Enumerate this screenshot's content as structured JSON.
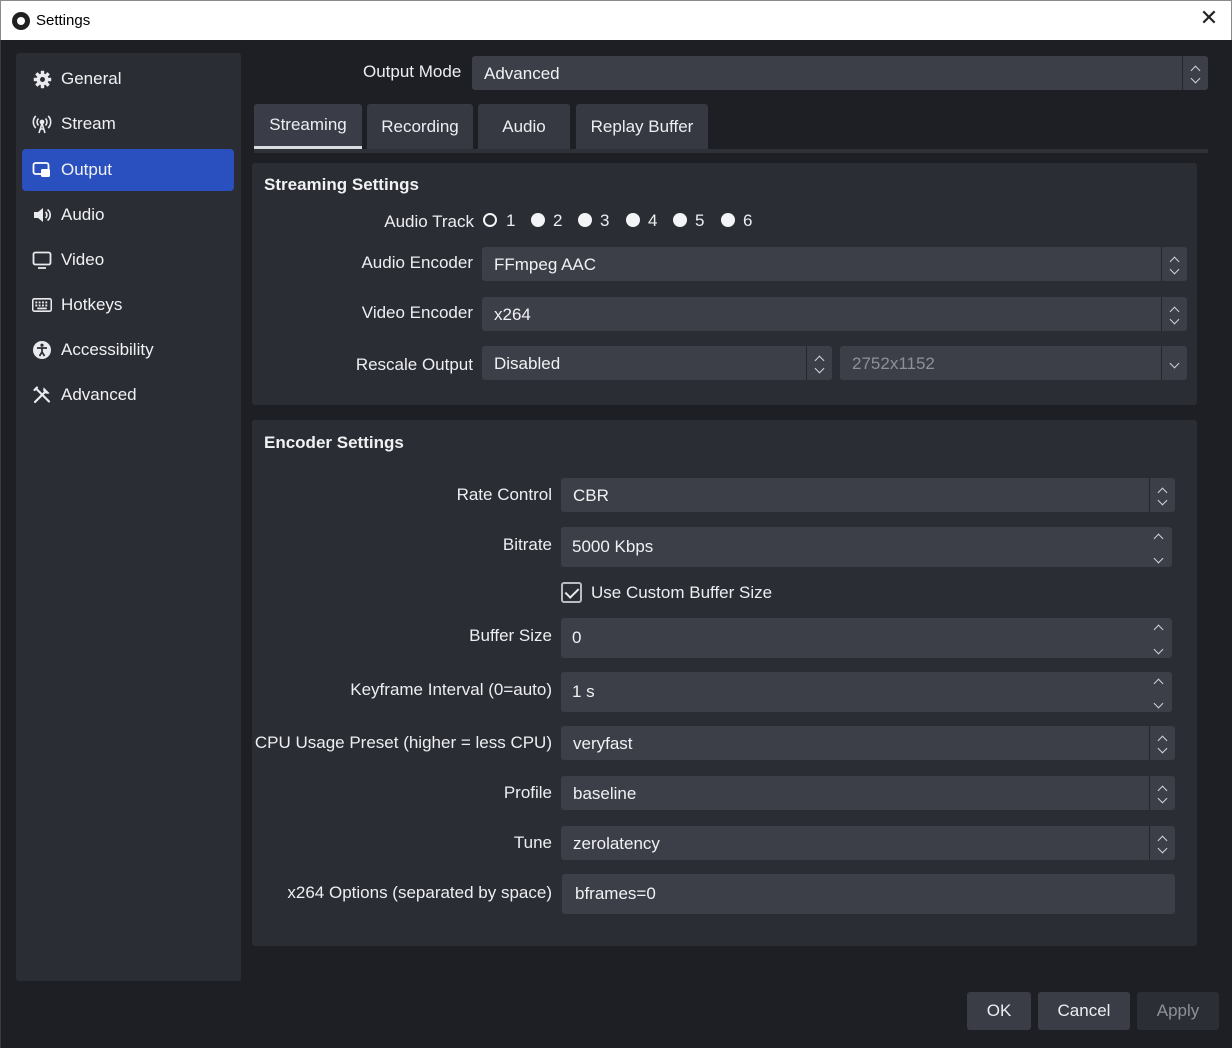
{
  "window": {
    "title": "Settings",
    "close_glyph": "✕"
  },
  "sidebar": {
    "items": [
      {
        "label": "General",
        "icon": "gear-icon"
      },
      {
        "label": "Stream",
        "icon": "antenna-icon"
      },
      {
        "label": "Output",
        "icon": "output-icon",
        "active": true
      },
      {
        "label": "Audio",
        "icon": "speaker-icon"
      },
      {
        "label": "Video",
        "icon": "monitor-icon"
      },
      {
        "label": "Hotkeys",
        "icon": "keyboard-icon"
      },
      {
        "label": "Accessibility",
        "icon": "accessibility-icon"
      },
      {
        "label": "Advanced",
        "icon": "tools-icon"
      }
    ]
  },
  "output_mode": {
    "label": "Output Mode",
    "value": "Advanced"
  },
  "tabs": [
    {
      "label": "Streaming",
      "active": true
    },
    {
      "label": "Recording"
    },
    {
      "label": "Audio"
    },
    {
      "label": "Replay Buffer"
    }
  ],
  "streaming_settings": {
    "title": "Streaming Settings",
    "audio_track_label": "Audio Track",
    "audio_tracks": [
      "1",
      "2",
      "3",
      "4",
      "5",
      "6"
    ],
    "audio_track_selected": "1",
    "audio_encoder_label": "Audio Encoder",
    "audio_encoder_value": "FFmpeg AAC",
    "video_encoder_label": "Video Encoder",
    "video_encoder_value": "x264",
    "rescale_label": "Rescale Output",
    "rescale_value": "Disabled",
    "rescale_resolution": "2752x1152"
  },
  "encoder_settings": {
    "title": "Encoder Settings",
    "rate_control_label": "Rate Control",
    "rate_control_value": "CBR",
    "bitrate_label": "Bitrate",
    "bitrate_value": "5000 Kbps",
    "custom_buffer_label": "Use Custom Buffer Size",
    "custom_buffer_checked": true,
    "buffer_size_label": "Buffer Size",
    "buffer_size_value": "0",
    "keyframe_label": "Keyframe Interval (0=auto)",
    "keyframe_value": "1 s",
    "cpu_preset_label": "CPU Usage Preset (higher = less CPU)",
    "cpu_preset_value": "veryfast",
    "profile_label": "Profile",
    "profile_value": "baseline",
    "tune_label": "Tune",
    "tune_value": "zerolatency",
    "x264_options_label": "x264 Options (separated by space)",
    "x264_options_value": "bframes=0"
  },
  "buttons": {
    "ok": "OK",
    "cancel": "Cancel",
    "apply": "Apply"
  },
  "colors": {
    "accent": "#2a50c0",
    "panel": "#2b2d34",
    "field": "#3c3f48",
    "background": "#1e1f24"
  }
}
